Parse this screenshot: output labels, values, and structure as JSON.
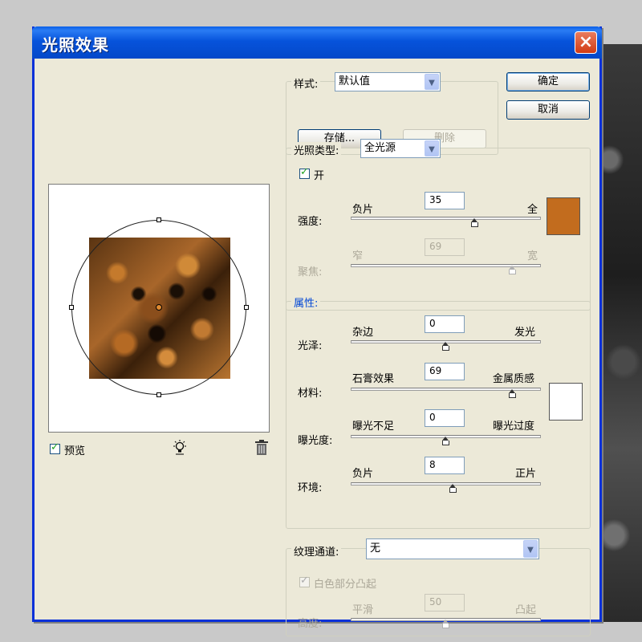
{
  "window": {
    "title": "光照效果"
  },
  "colors": {
    "light_color": "#c26c1e",
    "material_color": "#ffffff",
    "title_bar": "#0653db"
  },
  "preview": {
    "checkbox_label": "预览",
    "checked": true
  },
  "style": {
    "label": "样式:",
    "value": "默认值",
    "save_button": "存储...",
    "delete_button": "删除"
  },
  "buttons": {
    "ok": "确定",
    "cancel": "取消"
  },
  "light_type": {
    "label": "光照类型:",
    "value": "全光源",
    "on_label": "开",
    "on_checked": true,
    "intensity": {
      "label": "强度:",
      "left": "负片",
      "right": "全",
      "value": "35",
      "fraction": 0.65
    },
    "focus": {
      "label": "聚焦:",
      "left": "窄",
      "right": "宽",
      "value": "69",
      "fraction": 0.85
    }
  },
  "properties": {
    "title": "属性:",
    "gloss": {
      "label": "光泽:",
      "left": "杂边",
      "right": "发光",
      "value": "0",
      "fraction": 0.5
    },
    "material": {
      "label": "材料:",
      "left": "石膏效果",
      "right": "金属质感",
      "value": "69",
      "fraction": 0.85
    },
    "exposure": {
      "label": "曝光度:",
      "left": "曝光不足",
      "right": "曝光过度",
      "value": "0",
      "fraction": 0.5
    },
    "ambience": {
      "label": "环境:",
      "left": "负片",
      "right": "正片",
      "value": "8",
      "fraction": 0.54
    }
  },
  "texture": {
    "label": "纹理通道:",
    "value": "无",
    "white_high_label": "白色部分凸起",
    "white_high_checked": true,
    "height": {
      "label": "高度:",
      "left": "平滑",
      "right": "凸起",
      "value": "50",
      "fraction": 0.5
    }
  }
}
